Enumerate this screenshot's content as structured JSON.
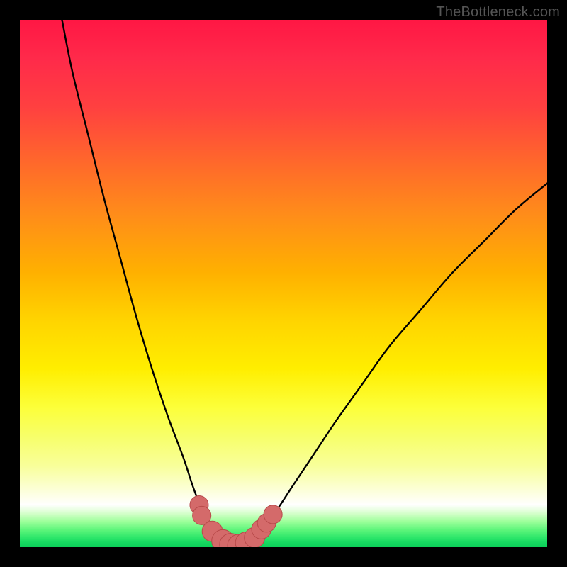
{
  "watermark": "TheBottleneck.com",
  "chart_data": {
    "type": "line",
    "title": "",
    "xlabel": "",
    "ylabel": "",
    "xlim": [
      0,
      100
    ],
    "ylim": [
      0,
      100
    ],
    "annotations": [],
    "curve_points": [
      {
        "x": 8.0,
        "y": 100.0
      },
      {
        "x": 10.0,
        "y": 90.0
      },
      {
        "x": 13.0,
        "y": 78.0
      },
      {
        "x": 16.0,
        "y": 66.0
      },
      {
        "x": 19.0,
        "y": 55.0
      },
      {
        "x": 22.0,
        "y": 44.0
      },
      {
        "x": 25.0,
        "y": 34.0
      },
      {
        "x": 28.0,
        "y": 25.0
      },
      {
        "x": 31.0,
        "y": 17.0
      },
      {
        "x": 33.0,
        "y": 11.0
      },
      {
        "x": 35.0,
        "y": 6.0
      },
      {
        "x": 37.0,
        "y": 2.5
      },
      {
        "x": 39.0,
        "y": 0.8
      },
      {
        "x": 41.0,
        "y": 0.2
      },
      {
        "x": 43.0,
        "y": 0.8
      },
      {
        "x": 45.0,
        "y": 2.5
      },
      {
        "x": 48.0,
        "y": 6.0
      },
      {
        "x": 52.0,
        "y": 12.0
      },
      {
        "x": 56.0,
        "y": 18.0
      },
      {
        "x": 60.0,
        "y": 24.0
      },
      {
        "x": 65.0,
        "y": 31.0
      },
      {
        "x": 70.0,
        "y": 38.0
      },
      {
        "x": 76.0,
        "y": 45.0
      },
      {
        "x": 82.0,
        "y": 52.0
      },
      {
        "x": 88.0,
        "y": 58.0
      },
      {
        "x": 94.0,
        "y": 64.0
      },
      {
        "x": 100.0,
        "y": 69.0
      }
    ],
    "markers": [
      {
        "x": 34.0,
        "y": 8.0,
        "r": 1.2
      },
      {
        "x": 34.5,
        "y": 6.0,
        "r": 1.2
      },
      {
        "x": 36.5,
        "y": 3.0,
        "r": 1.4
      },
      {
        "x": 38.5,
        "y": 1.2,
        "r": 1.6
      },
      {
        "x": 40.0,
        "y": 0.5,
        "r": 1.6
      },
      {
        "x": 41.5,
        "y": 0.3,
        "r": 1.6
      },
      {
        "x": 43.0,
        "y": 0.8,
        "r": 1.6
      },
      {
        "x": 44.5,
        "y": 1.8,
        "r": 1.4
      },
      {
        "x": 45.8,
        "y": 3.4,
        "r": 1.3
      },
      {
        "x": 46.8,
        "y": 4.6,
        "r": 1.2
      },
      {
        "x": 48.0,
        "y": 6.2,
        "r": 1.2
      }
    ],
    "colors": {
      "curve": "#000000",
      "marker_fill": "#d46a6a",
      "marker_stroke": "#b84a4a"
    }
  }
}
